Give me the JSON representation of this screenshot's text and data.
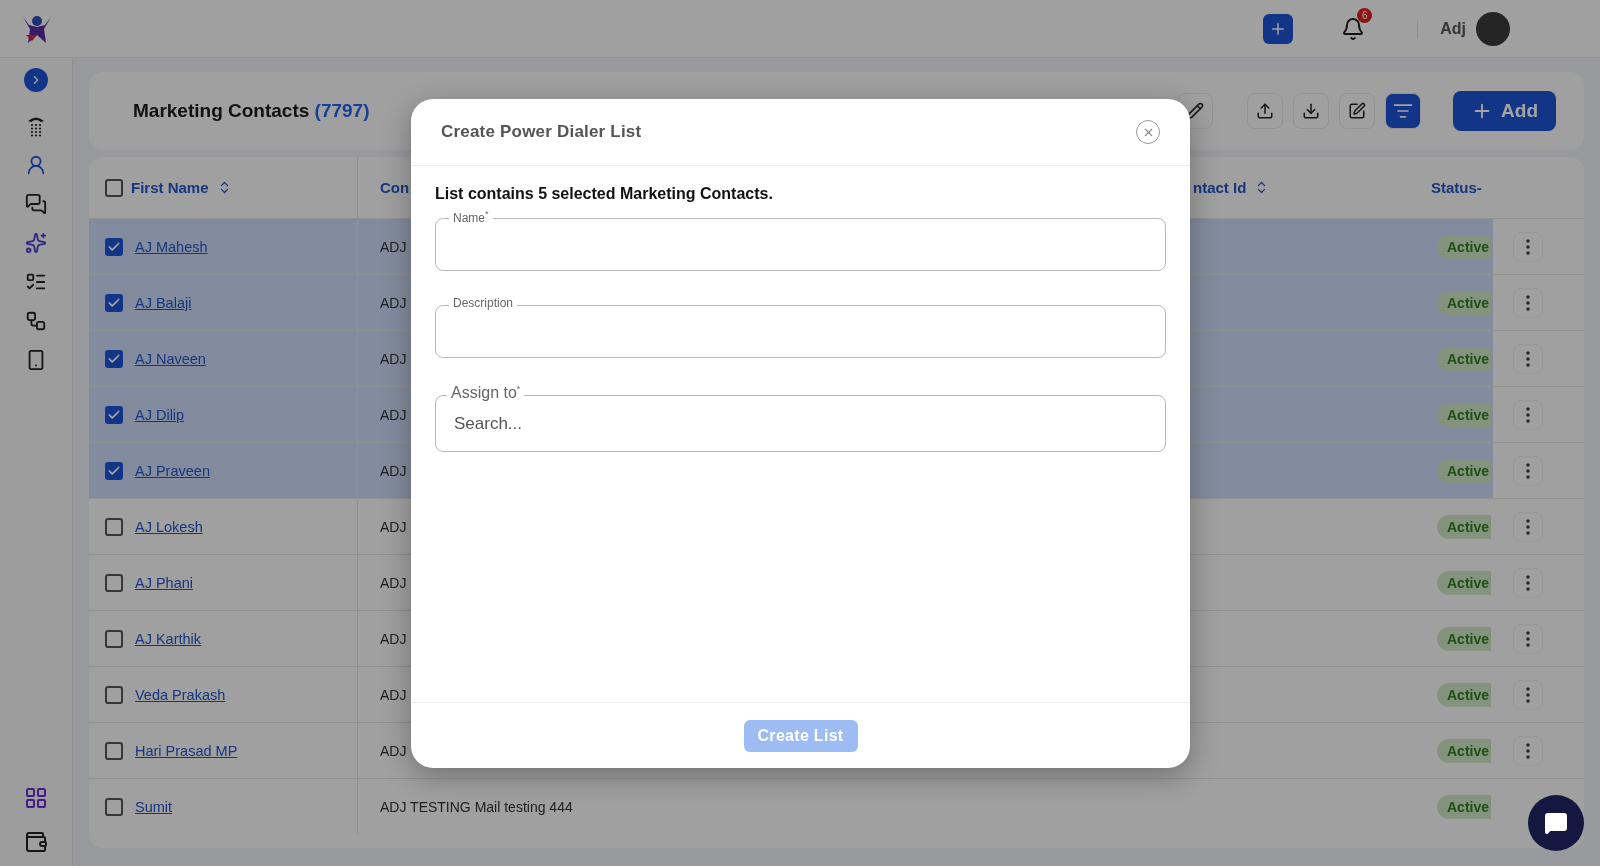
{
  "topbar": {
    "notification_count": "6",
    "user_name": "Adj"
  },
  "page": {
    "title": "Marketing Contacts",
    "count": "(7797)"
  },
  "toolbar": {
    "add_label": "Add",
    "filter_on": true
  },
  "table": {
    "header_checked": false,
    "columns": [
      {
        "label": "First Name",
        "sortable": true
      },
      {
        "label": "Con",
        "sortable": false
      },
      {
        "label": "ntact Id",
        "sortable": true
      },
      {
        "label": "Status-",
        "sortable": false
      }
    ],
    "rows": [
      {
        "first_name": "AJ Mahesh",
        "column_2": "ADJ",
        "status": "Active",
        "selected": true
      },
      {
        "first_name": "AJ Balaji",
        "column_2": "ADJ",
        "status": "Active",
        "selected": true
      },
      {
        "first_name": "AJ Naveen",
        "column_2": "ADJ",
        "status": "Active",
        "selected": true
      },
      {
        "first_name": "AJ Dilip",
        "column_2": "ADJ",
        "status": "Active",
        "selected": true
      },
      {
        "first_name": "AJ Praveen",
        "column_2": "ADJ",
        "status": "Active",
        "selected": true
      },
      {
        "first_name": "AJ Lokesh",
        "column_2": "ADJ",
        "status": "Active",
        "selected": false
      },
      {
        "first_name": "AJ Phani",
        "column_2": "ADJ",
        "status": "Active",
        "selected": false
      },
      {
        "first_name": "AJ Karthik",
        "column_2": "ADJ",
        "status": "Active",
        "selected": false
      },
      {
        "first_name": "Veda Prakash",
        "column_2": "ADJ",
        "status": "Active",
        "selected": false
      },
      {
        "first_name": "Hari Prasad MP",
        "column_2": "ADJ",
        "status": "Active",
        "selected": false
      },
      {
        "first_name": "Sumit",
        "column_2": "ADJ TESTING Mail testing 444",
        "status": "Active",
        "selected": false
      }
    ]
  },
  "dialog": {
    "title": "Create Power Dialer List",
    "message": "List contains 5 selected Marketing Contacts.",
    "fields": [
      {
        "kind": "text",
        "label": "Name$^{*}$"
      },
      {
        "kind": "text",
        "label": "Description"
      },
      {
        "kind": "autocomplete",
        "label": "Assign to$^{*}$",
        "placeholder": "Search..."
      }
    ],
    "submit": {
      "label": "Create List",
      "disabled": true
    }
  }
}
